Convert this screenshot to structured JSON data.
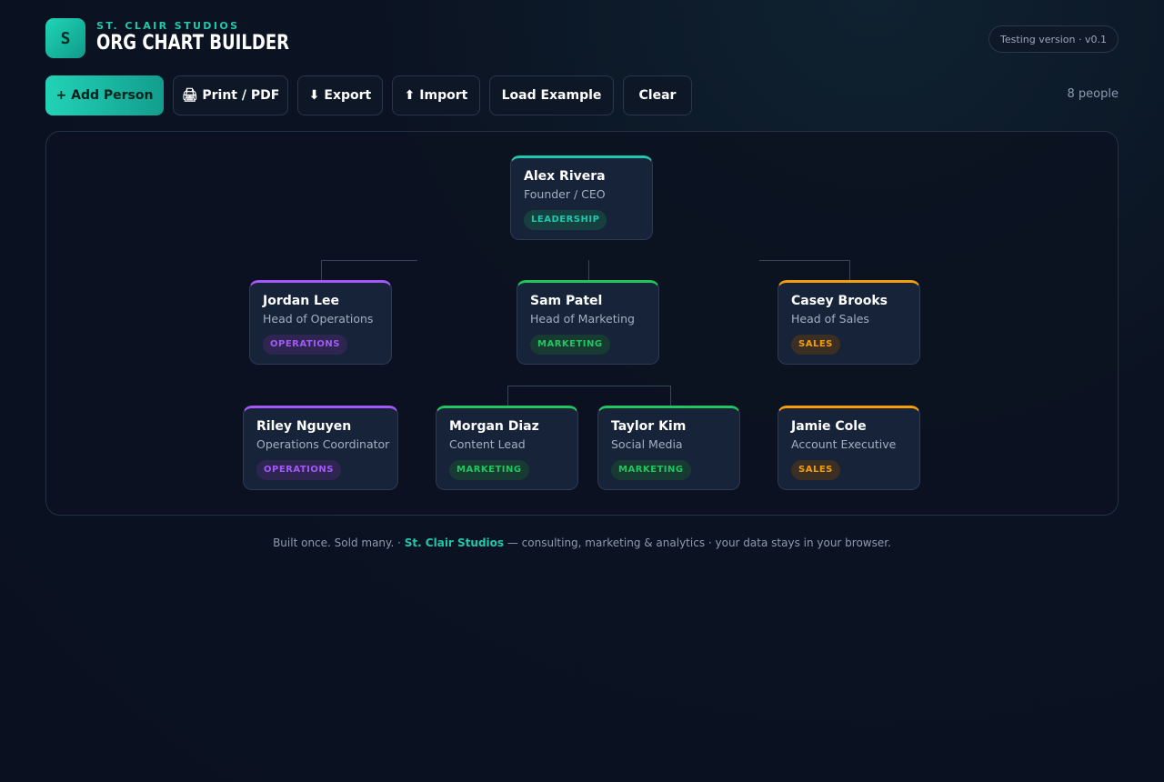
{
  "header": {
    "logo_letter": "S",
    "brand_sub": "ST. CLAIR STUDIOS",
    "title": "ORG CHART BUILDER",
    "version": "Testing version · v0.1"
  },
  "toolbar": {
    "add_person": "+ Add Person",
    "print": "🖨 Print / PDF",
    "export": "⬇ Export",
    "import": "⬆ Import",
    "load_example": "Load Example",
    "clear": "Clear",
    "people_count": "8 people"
  },
  "colors": {
    "leadership": "#1fc7ad",
    "operations": "#a259f7",
    "marketing": "#22c55e",
    "sales": "#f59e0b"
  },
  "people": [
    {
      "name": "Alex Rivera",
      "role": "Founder / CEO",
      "dept": "LEADERSHIP"
    },
    {
      "name": "Jordan Lee",
      "role": "Head of Operations",
      "dept": "OPERATIONS"
    },
    {
      "name": "Sam Patel",
      "role": "Head of Marketing",
      "dept": "MARKETING"
    },
    {
      "name": "Casey Brooks",
      "role": "Head of Sales",
      "dept": "SALES"
    },
    {
      "name": "Riley Nguyen",
      "role": "Operations Coordinator",
      "dept": "OPERATIONS"
    },
    {
      "name": "Morgan Diaz",
      "role": "Content Lead",
      "dept": "MARKETING"
    },
    {
      "name": "Taylor Kim",
      "role": "Social Media",
      "dept": "MARKETING"
    },
    {
      "name": "Jamie Cole",
      "role": "Account Executive",
      "dept": "SALES"
    }
  ],
  "footer": {
    "part1": "Built once. Sold many.  ·  ",
    "studio": "St. Clair Studios",
    "part2": " — consulting, marketing & analytics  ·  your data stays in your browser."
  }
}
